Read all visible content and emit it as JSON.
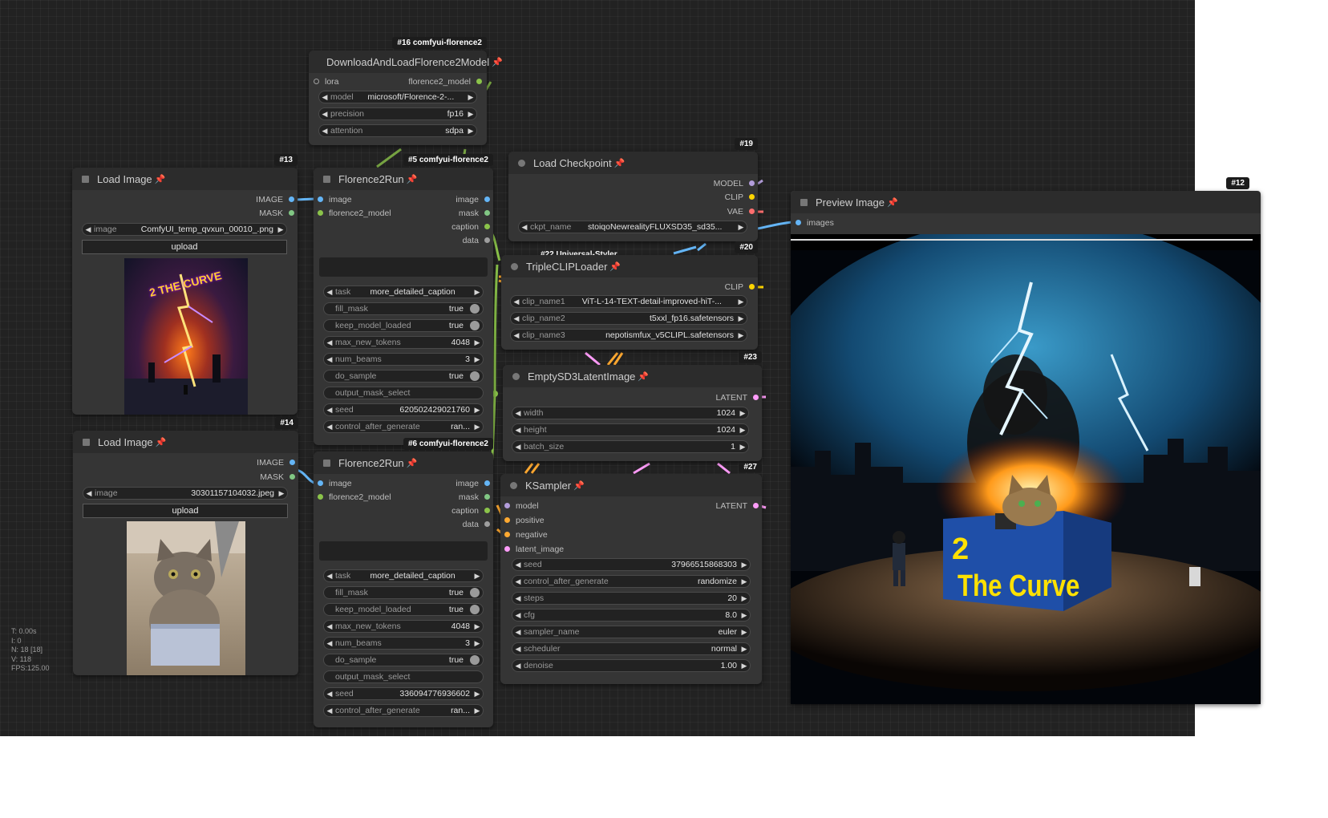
{
  "colors": {
    "image": "#64b5f6",
    "mask": "#81c784",
    "florence": "#8bc34a",
    "string": "#9e9e9e",
    "model": "#b39ddb",
    "clip": "#ffd500",
    "vae": "#ff6e6e",
    "latent": "#ff9cf9",
    "conditioning": "#ffa931"
  },
  "stats": {
    "t": "T: 0.00s",
    "i": "I: 0",
    "n": "N: 18 [18]",
    "v": "V: 118",
    "fps": "FPS:125.00"
  },
  "nodes": {
    "n16": {
      "badge": "#16 comfyui-florence2",
      "title": "DownloadAndLoadFlorence2Model",
      "in_lora": "lora",
      "out_model": "florence2_model",
      "w_model_name": "model",
      "w_model_val": "microsoft/Florence-2-...",
      "w_precision_name": "precision",
      "w_precision_val": "fp16",
      "w_attention_name": "attention",
      "w_attention_val": "sdpa"
    },
    "n13": {
      "badge": "#13",
      "title": "Load Image",
      "out_image": "IMAGE",
      "out_mask": "MASK",
      "w_image_name": "image",
      "w_image_val": "ComfyUI_temp_qvxun_00010_.png",
      "upload": "upload",
      "thumb_text": "2 THE CURVE"
    },
    "n14": {
      "badge": "#14",
      "title": "Load Image",
      "out_image": "IMAGE",
      "out_mask": "MASK",
      "w_image_name": "image",
      "w_image_val": "30301157104032.jpeg",
      "upload": "upload"
    },
    "n5": {
      "badge": "#5 comfyui-florence2",
      "title": "Florence2Run",
      "in_image": "image",
      "in_model": "florence2_model",
      "out_image": "image",
      "out_mask": "mask",
      "out_caption": "caption",
      "out_data": "data",
      "w_task_name": "task",
      "w_task_val": "more_detailed_caption",
      "w_fill_mask": "fill_mask",
      "w_fill_mask_val": "true",
      "w_keep": "keep_model_loaded",
      "w_keep_val": "true",
      "w_max_tokens": "max_new_tokens",
      "w_max_tokens_val": "4048",
      "w_beams": "num_beams",
      "w_beams_val": "3",
      "w_sample": "do_sample",
      "w_sample_val": "true",
      "w_output_mask": "output_mask_select",
      "w_seed": "seed",
      "w_seed_val": "620502429021760",
      "w_control": "control_after_generate",
      "w_control_val": "ran..."
    },
    "n6": {
      "badge": "#6 comfyui-florence2",
      "title": "Florence2Run",
      "in_image": "image",
      "in_model": "florence2_model",
      "out_image": "image",
      "out_mask": "mask",
      "out_caption": "caption",
      "out_data": "data",
      "w_task_name": "task",
      "w_task_val": "more_detailed_caption",
      "w_fill_mask": "fill_mask",
      "w_fill_mask_val": "true",
      "w_keep": "keep_model_loaded",
      "w_keep_val": "true",
      "w_max_tokens": "max_new_tokens",
      "w_max_tokens_val": "4048",
      "w_beams": "num_beams",
      "w_beams_val": "3",
      "w_sample": "do_sample",
      "w_sample_val": "true",
      "w_output_mask": "output_mask_select",
      "w_seed": "seed",
      "w_seed_val": "336094776936602",
      "w_control": "control_after_generate",
      "w_control_val": "ran..."
    },
    "n19": {
      "badge": "#19",
      "title": "Load Checkpoint",
      "out_model": "MODEL",
      "out_clip": "CLIP",
      "out_vae": "VAE",
      "w_ckpt_name": "ckpt_name",
      "w_ckpt_val": "stoiqoNewrealityFLUXSD35_sd35..."
    },
    "n22": {
      "badge": "#22 Universal-Styler"
    },
    "n20": {
      "badge": "#20",
      "title": "TripleCLIPLoader",
      "out_clip": "CLIP",
      "w_clip1": "clip_name1",
      "w_clip1_val": "ViT-L-14-TEXT-detail-improved-hiT-...",
      "w_clip2": "clip_name2",
      "w_clip2_val": "t5xxl_fp16.safetensors",
      "w_clip3": "clip_name3",
      "w_clip3_val": "nepotismfux_v5CLIPL.safetensors"
    },
    "n23": {
      "badge": "#23",
      "title": "EmptySD3LatentImage",
      "out_latent": "LATENT",
      "w_width": "width",
      "w_width_val": "1024",
      "w_height": "height",
      "w_height_val": "1024",
      "w_batch": "batch_size",
      "w_batch_val": "1"
    },
    "n27": {
      "badge": "#27",
      "title": "KSampler",
      "in_model": "model",
      "in_positive": "positive",
      "in_negative": "negative",
      "in_latent": "latent_image",
      "out_latent": "LATENT",
      "w_seed": "seed",
      "w_seed_val": "37966515868303",
      "w_control": "control_after_generate",
      "w_control_val": "randomize",
      "w_steps": "steps",
      "w_steps_val": "20",
      "w_cfg": "cfg",
      "w_cfg_val": "8.0",
      "w_sampler": "sampler_name",
      "w_sampler_val": "euler",
      "w_scheduler": "scheduler",
      "w_scheduler_val": "normal",
      "w_denoise": "denoise",
      "w_denoise_val": "1.00"
    },
    "n12": {
      "badge": "#12",
      "title": "Preview Image",
      "in_images": "images",
      "art_title_num": "2",
      "art_title_text": "The Curve"
    }
  }
}
